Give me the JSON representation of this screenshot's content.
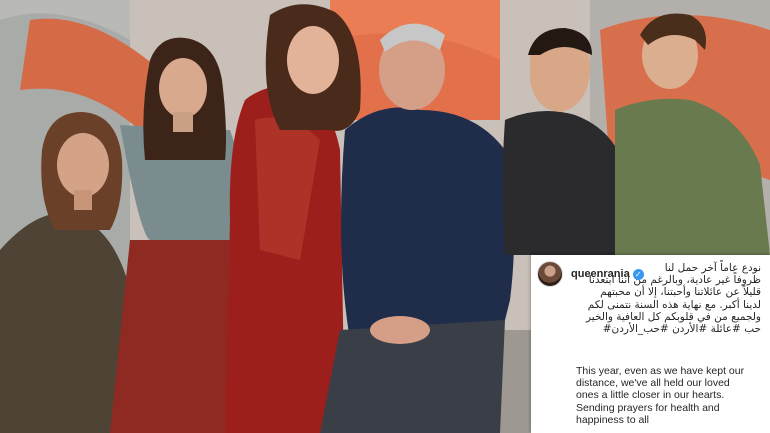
{
  "post": {
    "username": "queenrania",
    "verified_icon": "verified-badge-icon",
    "caption_arabic": [
      "نودع عاماً آخر حمل لنا",
      "ظروفاً غير عادية، وبالرغم من أننا ابتعدنا",
      "قليلاً عن عائلاتنا وأحبتنا، إلا أن محبتهم",
      "لدينا أكبر. مع نهاية هذه السنة نتمنى لكم",
      "ولجميع من في قلوبكم كل العافية والخير",
      "حب #عائلة #الأردن #حب_الأردن#"
    ],
    "caption_english": [
      "This year, even as we have kept our",
      "distance, we've all held our loved",
      "ones a little closer in our hearts.",
      "Sending prayers for health and",
      "happiness to all"
    ]
  },
  "colors": {
    "accent_blue": "#3897f0",
    "wall_orange": "#e2704a",
    "red_dress": "#9c1f1c"
  }
}
